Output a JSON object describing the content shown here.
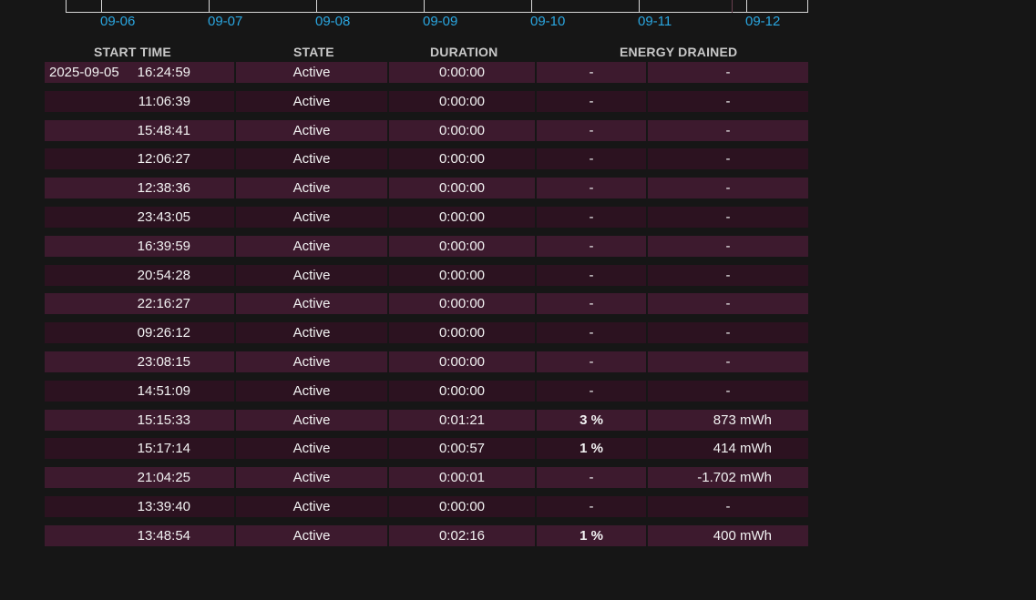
{
  "timeline": {
    "labels": [
      "09-06",
      "09-07",
      "09-08",
      "09-09",
      "09-10",
      "09-11",
      "09-12"
    ]
  },
  "table": {
    "headers": {
      "start_time": "START TIME",
      "state": "STATE",
      "duration": "DURATION",
      "energy_drained": "ENERGY DRAINED"
    },
    "rows": [
      {
        "date": "2025-09-05",
        "time": "16:24:59",
        "state": "Active",
        "duration": "0:00:00",
        "percent": "-",
        "energy": "-"
      },
      {
        "date": "",
        "time": "11:06:39",
        "state": "Active",
        "duration": "0:00:00",
        "percent": "-",
        "energy": "-"
      },
      {
        "date": "",
        "time": "15:48:41",
        "state": "Active",
        "duration": "0:00:00",
        "percent": "-",
        "energy": "-"
      },
      {
        "date": "",
        "time": "12:06:27",
        "state": "Active",
        "duration": "0:00:00",
        "percent": "-",
        "energy": "-"
      },
      {
        "date": "",
        "time": "12:38:36",
        "state": "Active",
        "duration": "0:00:00",
        "percent": "-",
        "energy": "-"
      },
      {
        "date": "",
        "time": "23:43:05",
        "state": "Active",
        "duration": "0:00:00",
        "percent": "-",
        "energy": "-"
      },
      {
        "date": "",
        "time": "16:39:59",
        "state": "Active",
        "duration": "0:00:00",
        "percent": "-",
        "energy": "-"
      },
      {
        "date": "",
        "time": "20:54:28",
        "state": "Active",
        "duration": "0:00:00",
        "percent": "-",
        "energy": "-"
      },
      {
        "date": "",
        "time": "22:16:27",
        "state": "Active",
        "duration": "0:00:00",
        "percent": "-",
        "energy": "-"
      },
      {
        "date": "",
        "time": "09:26:12",
        "state": "Active",
        "duration": "0:00:00",
        "percent": "-",
        "energy": "-"
      },
      {
        "date": "",
        "time": "23:08:15",
        "state": "Active",
        "duration": "0:00:00",
        "percent": "-",
        "energy": "-"
      },
      {
        "date": "",
        "time": "14:51:09",
        "state": "Active",
        "duration": "0:00:00",
        "percent": "-",
        "energy": "-"
      },
      {
        "date": "",
        "time": "15:15:33",
        "state": "Active",
        "duration": "0:01:21",
        "percent": "3 %",
        "energy": "873 mWh"
      },
      {
        "date": "",
        "time": "15:17:14",
        "state": "Active",
        "duration": "0:00:57",
        "percent": "1 %",
        "energy": "414 mWh"
      },
      {
        "date": "",
        "time": "21:04:25",
        "state": "Active",
        "duration": "0:00:01",
        "percent": "-",
        "energy": "-1.702 mWh"
      },
      {
        "date": "",
        "time": "13:39:40",
        "state": "Active",
        "duration": "0:00:00",
        "percent": "-",
        "energy": "-"
      },
      {
        "date": "",
        "time": "13:48:54",
        "state": "Active",
        "duration": "0:02:16",
        "percent": "1 %",
        "energy": "400 mWh"
      }
    ]
  },
  "colors": {
    "background": "#161616",
    "row_odd": "#3d1a2e",
    "row_even": "#2c1220",
    "timeline_label": "#2aa6e0",
    "header_text": "#c8c8c8"
  }
}
